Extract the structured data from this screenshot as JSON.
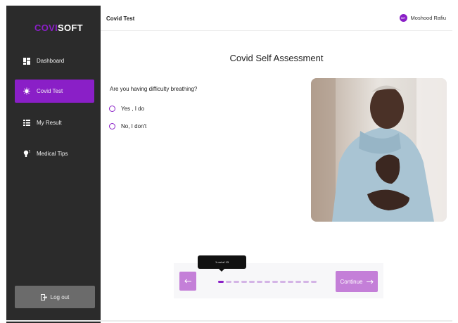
{
  "brand": {
    "part1": "COVI",
    "part2": "SOFT"
  },
  "sidebar": {
    "items": [
      {
        "label": "Dashboard",
        "icon": "dashboard-icon"
      },
      {
        "label": "Covid Test",
        "icon": "virus-icon",
        "active": true
      },
      {
        "label": "My Result",
        "icon": "list-icon"
      },
      {
        "label": "Medical Tips",
        "icon": "lightbulb-icon"
      }
    ],
    "logout_label": "Log out"
  },
  "header": {
    "title": "Covid Test",
    "user_name": "Moshood Rafiu",
    "user_initials": "MR"
  },
  "main": {
    "title": "Covid Self Assessment",
    "question": "Are you having difficulty breathing?",
    "options": [
      "Yes , I do",
      "No, I don't"
    ]
  },
  "stepper": {
    "tooltip": "1 out of 13",
    "current": 1,
    "total": 13,
    "continue_label": "Continue"
  },
  "colors": {
    "accent": "#8a1fc7",
    "accent_light": "#c47fd8",
    "sidebar_bg": "#2b2b2b",
    "logout_bg": "#6b6b6b"
  }
}
